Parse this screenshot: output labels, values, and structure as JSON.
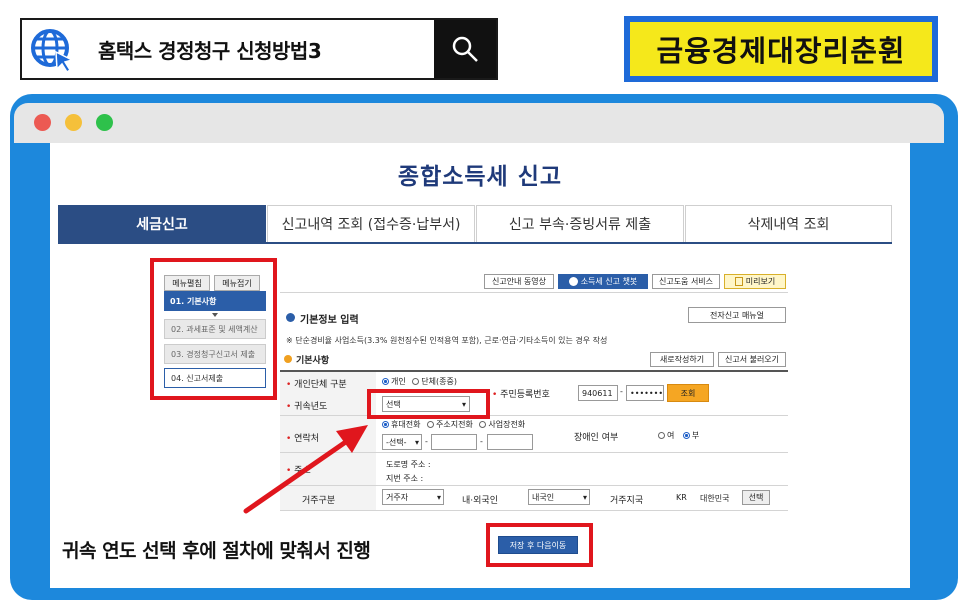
{
  "header": {
    "search_text": "홈택스 경정청구 신청방법3",
    "brand_text": "금융경제대장리춘휜"
  },
  "page": {
    "title": "종합소득세 신고",
    "tabs": [
      {
        "label": "세금신고"
      },
      {
        "label": "신고내역 조회 (접수증·납부서)"
      },
      {
        "label": "신고 부속·증빙서류 제출"
      },
      {
        "label": "삭제내역 조회"
      }
    ]
  },
  "menu": {
    "expand": "메뉴펼침",
    "collapse": "메뉴접기",
    "items": [
      {
        "label": "01. 기본사항"
      },
      {
        "label": "02. 과세표준 및 세액계산"
      },
      {
        "label": "03. 경정청구신고서 제출"
      },
      {
        "label": "04. 신고서제출"
      }
    ]
  },
  "form": {
    "top_buttons": {
      "guide_video": "신고안내 동영상",
      "chatbot": "소득세 신고 챗봇",
      "help_service": "신고도움 서비스",
      "preview": "미리보기"
    },
    "section_title": "기본정보 입력",
    "manual_button": "전자신고 매뉴얼",
    "notice": "※ 단순경비율 사업소득(3.3% 원천징수된 인적용역 포함), 근로·연금·기타소득이 있는 경우 작성",
    "sub_title": "기본사항",
    "new_write": "새로작성하기",
    "load_report": "신고서 불러오기",
    "rows": {
      "entity_type_label": "개인단체 구분",
      "entity_individual": "개인",
      "entity_group": "단체(종중)",
      "rrn_label": "주민등록번호",
      "rrn_front": "940611",
      "rrn_back": "•••••••",
      "lookup": "조회",
      "year_label": "귀속년도",
      "year_select": "선택",
      "contact_label": "연락처",
      "phone_mobile": "휴대전화",
      "phone_home": "주소지전화",
      "phone_work": "사업장전화",
      "phone_select": "-선택-",
      "disabled_label": "장애인 여부",
      "yes": "여",
      "no": "부",
      "address_label": "주소",
      "road_address": "도로명 주소 :",
      "lot_address": "지번 주소 :",
      "residence_label": "거주구분",
      "residence_value": "거주자",
      "nationality_label": "내·외국인",
      "nationality_value": "내국인",
      "country_label": "거주지국",
      "country_code": "KR",
      "country_name": "대한민국",
      "select_btn": "선택"
    },
    "save_next": "저장 후 다음이동"
  },
  "caption": "귀속 연도 선택 후에 절차에 맞춰서 진행",
  "colors": {
    "browser_blue": "#1d88dc",
    "highlight_red": "#e0161d",
    "tab_active": "#2b4d84",
    "title_navy": "#1f3a7a"
  }
}
